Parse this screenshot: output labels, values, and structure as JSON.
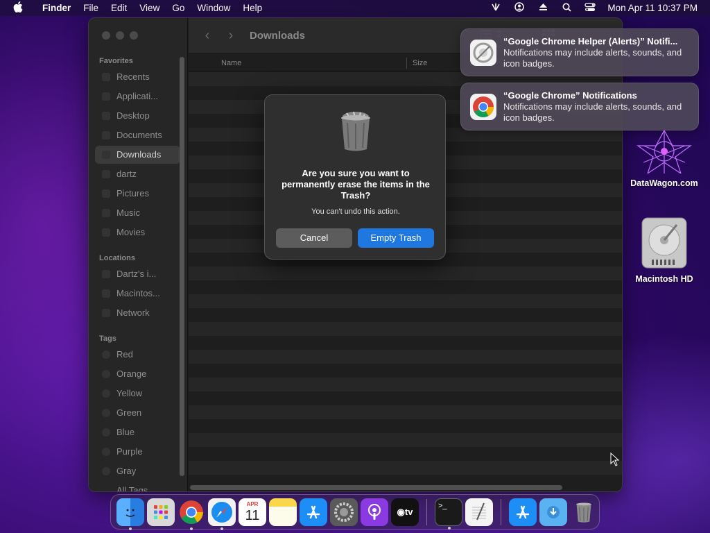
{
  "menubar": {
    "apple_icon": "apple-icon",
    "app_name": "Finder",
    "menus": [
      "File",
      "Edit",
      "View",
      "Go",
      "Window",
      "Help"
    ],
    "status_icons": [
      "wifi-icon",
      "user-icon",
      "eject-icon",
      "search-icon",
      "control-center-icon"
    ],
    "clock": "Mon Apr 11  10:37 PM"
  },
  "finder": {
    "title": "Downloads",
    "sidebar": {
      "favorites_heading": "Favorites",
      "favorites": [
        "Recents",
        "Applicati...",
        "Desktop",
        "Documents",
        "Downloads",
        "dartz",
        "Pictures",
        "Music",
        "Movies"
      ],
      "locations_heading": "Locations",
      "locations": [
        "Dartz's i...",
        "Macintos...",
        "Network"
      ],
      "tags_heading": "Tags",
      "tags": [
        "Red",
        "Orange",
        "Yellow",
        "Green",
        "Blue",
        "Purple",
        "Gray",
        "All Tags..."
      ]
    },
    "columns": {
      "name": "Name",
      "size": "Size"
    }
  },
  "dialog": {
    "heading": "Are you sure you want to permanently erase the items in the Trash?",
    "subtext": "You can't undo this action.",
    "cancel_label": "Cancel",
    "confirm_label": "Empty Trash"
  },
  "notifications": [
    {
      "title": "“Google Chrome Helper (Alerts)” Notifi...",
      "body": "Notifications may include alerts, sounds, and icon badges."
    },
    {
      "title": "“Google Chrome” Notifications",
      "body": "Notifications may include alerts, sounds, and icon badges."
    }
  ],
  "desktop": {
    "icons": [
      "DataWagon.com",
      "Macintosh HD"
    ]
  },
  "dock": {
    "calendar_month": "APR",
    "calendar_day": "11",
    "tv_label": "tv",
    "terminal_prompt": ">_"
  },
  "colors": {
    "accent": "#1f78e0",
    "dialog_bg": "#2f2f2f"
  }
}
